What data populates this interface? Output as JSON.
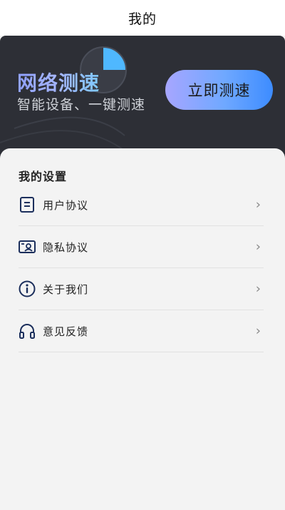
{
  "header": {
    "title": "我的"
  },
  "banner": {
    "title": "网络测速",
    "subtitle": "智能设备、一键测速",
    "button_label": "立即测速",
    "accent_start": "#a7a6ff",
    "accent_end": "#3d8cff"
  },
  "settings": {
    "section_title": "我的设置",
    "items": [
      {
        "label": "用户协议",
        "icon": "document-icon"
      },
      {
        "label": "隐私协议",
        "icon": "id-card-icon"
      },
      {
        "label": "关于我们",
        "icon": "info-icon"
      },
      {
        "label": "意见反馈",
        "icon": "headphones-icon"
      }
    ],
    "chevron": "›"
  }
}
